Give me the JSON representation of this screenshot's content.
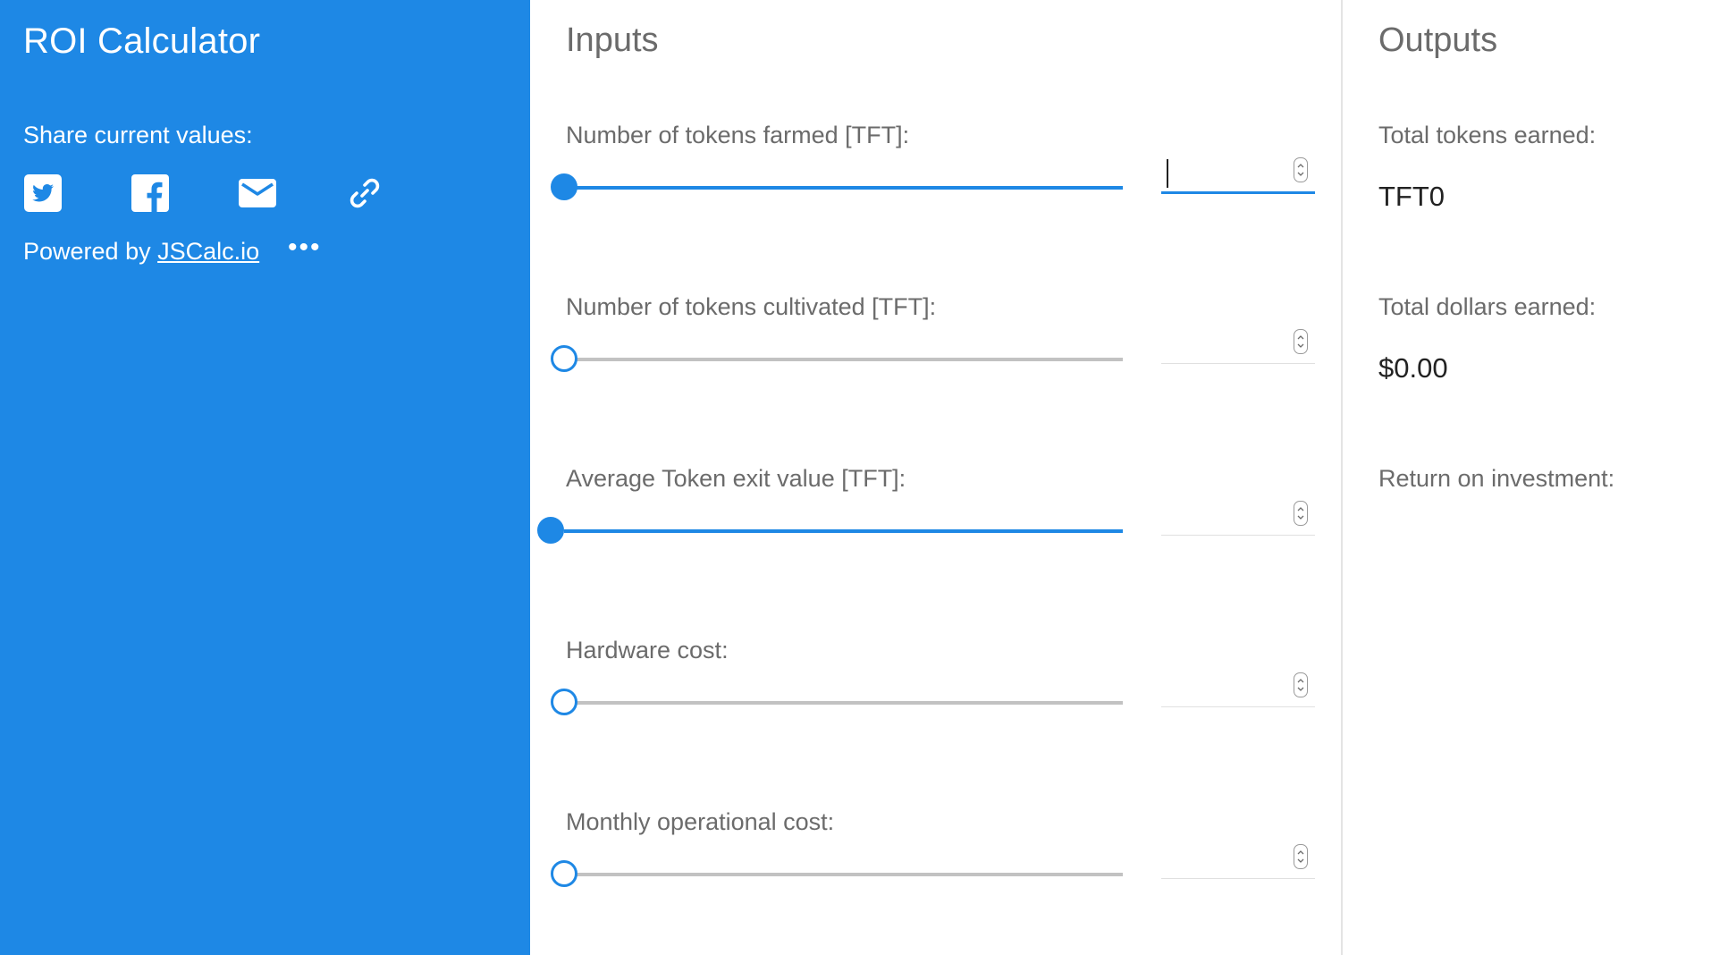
{
  "app": {
    "title": "ROI Calculator"
  },
  "sidebar": {
    "share_label": "Share current values:",
    "share_buttons": [
      "twitter-icon",
      "facebook-icon",
      "email-icon",
      "link-icon"
    ],
    "powered_prefix": "Powered by",
    "powered_link": "JSCalc.io",
    "more_label": "•••"
  },
  "inputs": {
    "title": "Inputs",
    "fields": [
      {
        "label": "Number of tokens farmed [TFT]:",
        "value": "",
        "slider_fraction": 0.0,
        "slider_active": true,
        "focused": true
      },
      {
        "label": "Number of tokens cultivated [TFT]:",
        "value": "",
        "slider_fraction": 0.0,
        "slider_active": false,
        "focused": false
      },
      {
        "label": "Average Token exit value [TFT]:",
        "value": "",
        "slider_fraction": 0.0,
        "slider_active": true,
        "focused": false
      },
      {
        "label": "Hardware cost:",
        "value": "",
        "slider_fraction": 0.0,
        "slider_active": false,
        "focused": false
      },
      {
        "label": "Monthly operational cost:",
        "value": "",
        "slider_fraction": 0.0,
        "slider_active": false,
        "focused": false
      }
    ]
  },
  "outputs": {
    "title": "Outputs",
    "items": [
      {
        "label": "Total tokens earned:",
        "value": "TFT0"
      },
      {
        "label": "Total dollars earned:",
        "value": "$0.00"
      },
      {
        "label": "Return on investment:",
        "value": ""
      }
    ]
  },
  "colors": {
    "accent": "#1e88e5",
    "muted_text": "#6b6b6b",
    "track": "#c2c2c2"
  }
}
